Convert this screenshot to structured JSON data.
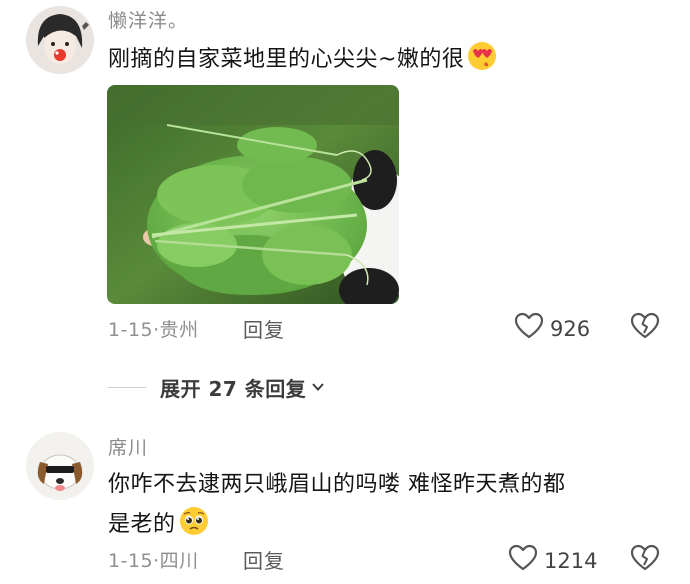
{
  "comment1": {
    "username": "懒洋洋。",
    "text": "刚摘的自家菜地里的心尖尖~嫩的很",
    "emoji": "heart-eyes-emoji",
    "date": "1-15",
    "location": "贵州",
    "reply_label": "回复",
    "likes": "926",
    "image_alt": "pea shoots photo"
  },
  "expand": {
    "label": "展开 27 条回复"
  },
  "comment2": {
    "username": "席川",
    "text_line1": "你咋不去逮两只峨眉山的吗喽 难怪昨天煮的都",
    "text_line2": "是老的",
    "emoji": "pleading-face-emoji",
    "date": "1-15",
    "location": "四川",
    "reply_label": "回复",
    "likes": "1214"
  },
  "colors": {
    "meta_gray": "#8f8f8f",
    "text": "#151515",
    "emoji_yellow": "#ffcc33"
  }
}
